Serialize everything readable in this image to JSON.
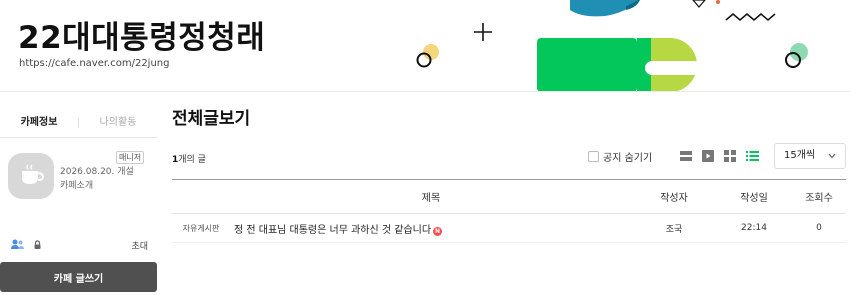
{
  "banner": {
    "cafe_name": "22대대통령정청래",
    "cafe_url": "https://cafe.naver.com/22jung"
  },
  "sidebar": {
    "tabs": [
      {
        "label": "카페정보",
        "active": true
      },
      {
        "label": "나의활동",
        "active": false
      }
    ],
    "manager_badge": "매니저",
    "open_date": "2026.08.20. 개설",
    "intro_link": "카페소개",
    "invite_link": "초대",
    "write_button": "카페 글쓰기"
  },
  "main": {
    "page_title": "전체글보기",
    "post_count_number": "1",
    "post_count_suffix": "개의 글",
    "notice_hide_label": "공지 숨기기",
    "per_page": "15개씩",
    "columns": {
      "title": "제목",
      "author": "작성자",
      "date": "작성일",
      "views": "조회수"
    },
    "posts": [
      {
        "board": "자유게시판",
        "title": "정 전 대표님 대통령은 너무 과하신 것 같습니다",
        "new_badge": "N",
        "author": "조국",
        "date": "22:14",
        "views": "0"
      }
    ]
  },
  "colors": {
    "new_badge": "#ff4b4b",
    "write_button": "#505050",
    "view_active": "#03c75a",
    "deco_green": "#03c75a",
    "deco_lime": "#b5d843",
    "deco_blue": "#1f8fb3",
    "deco_yellow": "#f3d77a"
  },
  "icons": {
    "cafe_icon": "coffee-cup-icon",
    "member": "members-icon",
    "lock": "lock-icon",
    "views": [
      "list-view-icon",
      "card-view-icon",
      "album-view-icon",
      "board-list-icon"
    ],
    "select": "chevron-down-icon"
  }
}
